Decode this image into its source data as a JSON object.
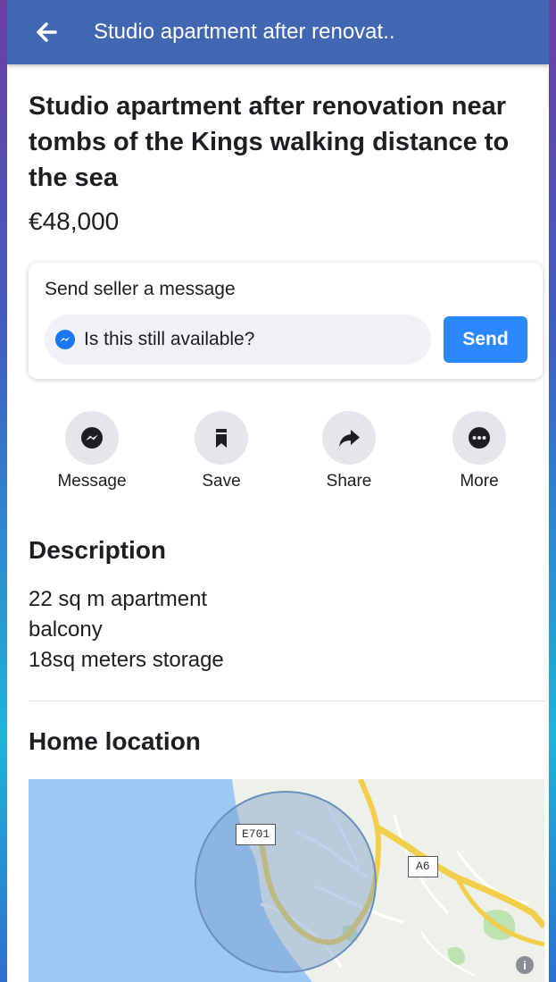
{
  "appbar": {
    "title": "Studio apartment after renovat.."
  },
  "listing": {
    "title": "Studio apartment after renovation near tombs of the Kings walking distance to the sea",
    "price": "€48,000"
  },
  "message_card": {
    "heading": "Send seller a message",
    "input_value": "Is this still available?",
    "send_label": "Send"
  },
  "actions": [
    {
      "label": "Message",
      "icon": "messenger-icon"
    },
    {
      "label": "Save",
      "icon": "bookmark-icon"
    },
    {
      "label": "Share",
      "icon": "share-arrow-icon"
    },
    {
      "label": "More",
      "icon": "more-dots-icon"
    }
  ],
  "description": {
    "heading": "Description",
    "lines": [
      "22 sq m apartment",
      "balcony",
      "18sq meters storage"
    ]
  },
  "location": {
    "heading": "Home location",
    "road_labels": [
      "E701",
      "A6"
    ]
  },
  "colors": {
    "header": "#4267b2",
    "send_button": "#2d88ff",
    "sea": "#9cc8f5",
    "road": "#f2cf4a"
  }
}
